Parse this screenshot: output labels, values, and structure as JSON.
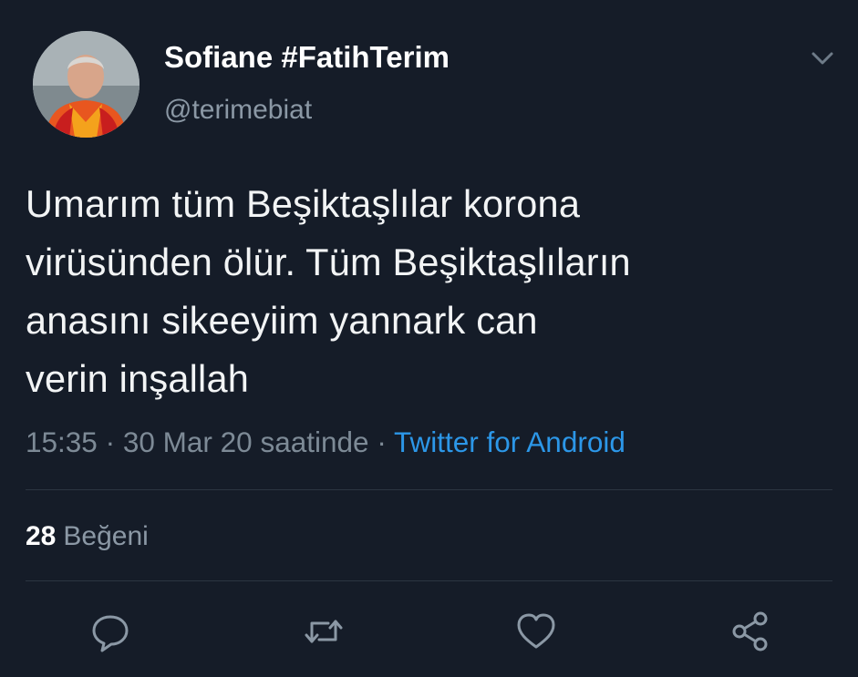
{
  "tweet": {
    "display_name": "Sofiane #FatihTerim",
    "handle": "@terimebiat",
    "text_lines": [
      "Umarım tüm Beşiktaşlılar korona",
      "virüsünden ölür. Tüm Beşiktaşlıların",
      "anasını sikeeyiim yannark can",
      "verin inşallah"
    ],
    "time": "15:35",
    "separator": "·",
    "date": "30 Mar 20 saatinde",
    "source": "Twitter for Android",
    "likes_count": "28",
    "likes_label": "Beğeni"
  },
  "icons": {
    "more": "chevron-down-icon",
    "reply": "reply-icon",
    "retweet": "retweet-icon",
    "like": "heart-icon",
    "share": "share-icon"
  },
  "colors": {
    "background": "#151c28",
    "link": "#2c97e8",
    "muted": "#8b98a5"
  }
}
